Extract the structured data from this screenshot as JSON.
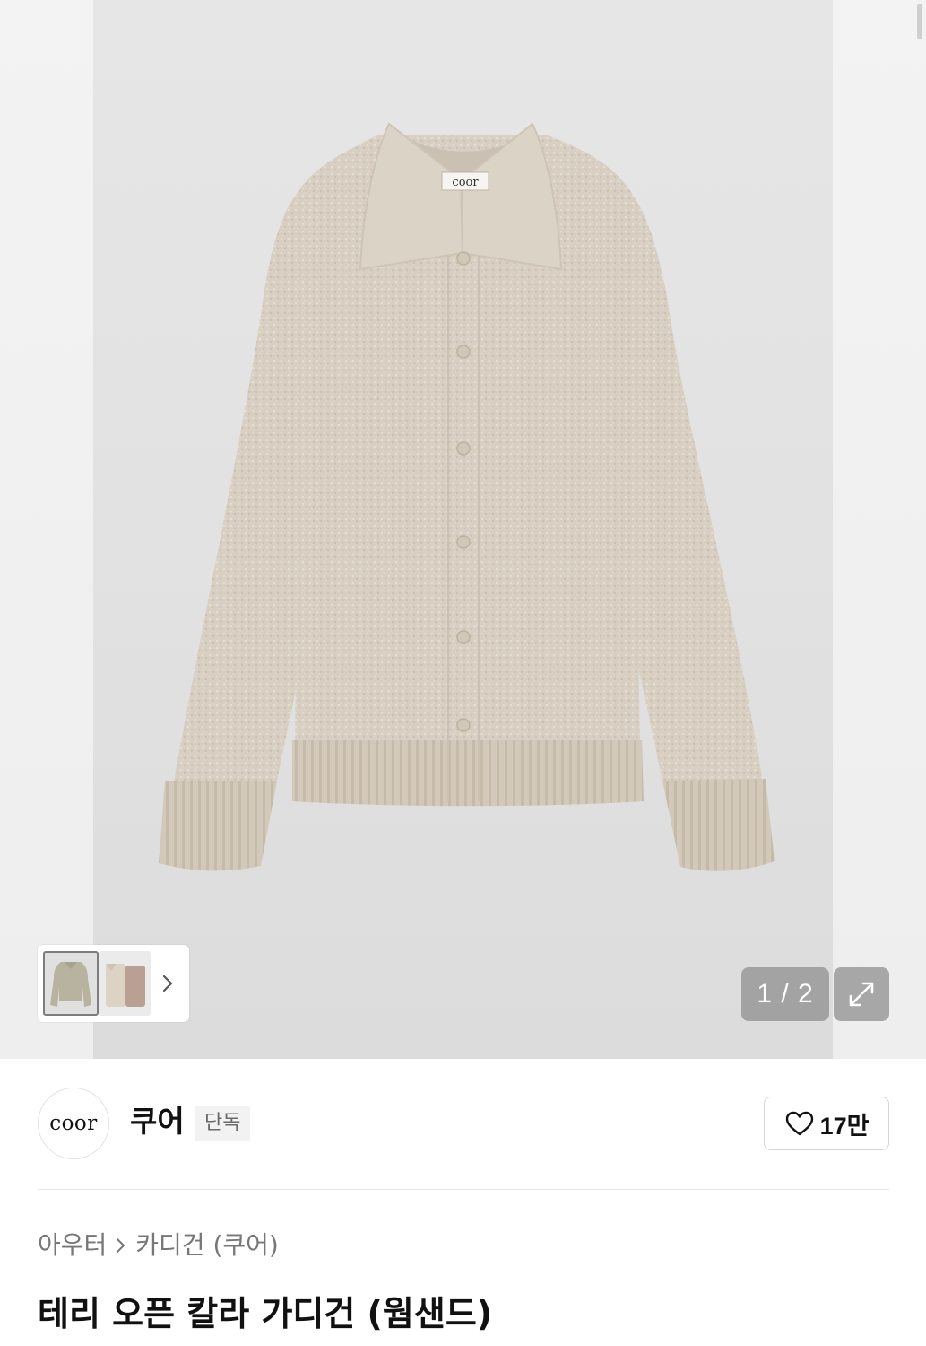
{
  "gallery": {
    "counter": "1 / 2",
    "garment_label": "coor",
    "colors": {
      "garment": "#d9d0c3",
      "garment_shadow": "#c9bfb1",
      "button": "#d2c6b6"
    },
    "icons": {
      "next": "chevron-right-icon",
      "expand": "expand-arrows-icon"
    }
  },
  "brand": {
    "logo_text": "coor",
    "name": "쿠어",
    "badge": "단독",
    "likes": "17만",
    "like_icon": "heart-outline-icon"
  },
  "breadcrumb": {
    "items": [
      "아우터",
      "카디건 (쿠어)"
    ]
  },
  "product": {
    "title": "테리 오픈 칼라 가디건 (웜샌드)"
  }
}
